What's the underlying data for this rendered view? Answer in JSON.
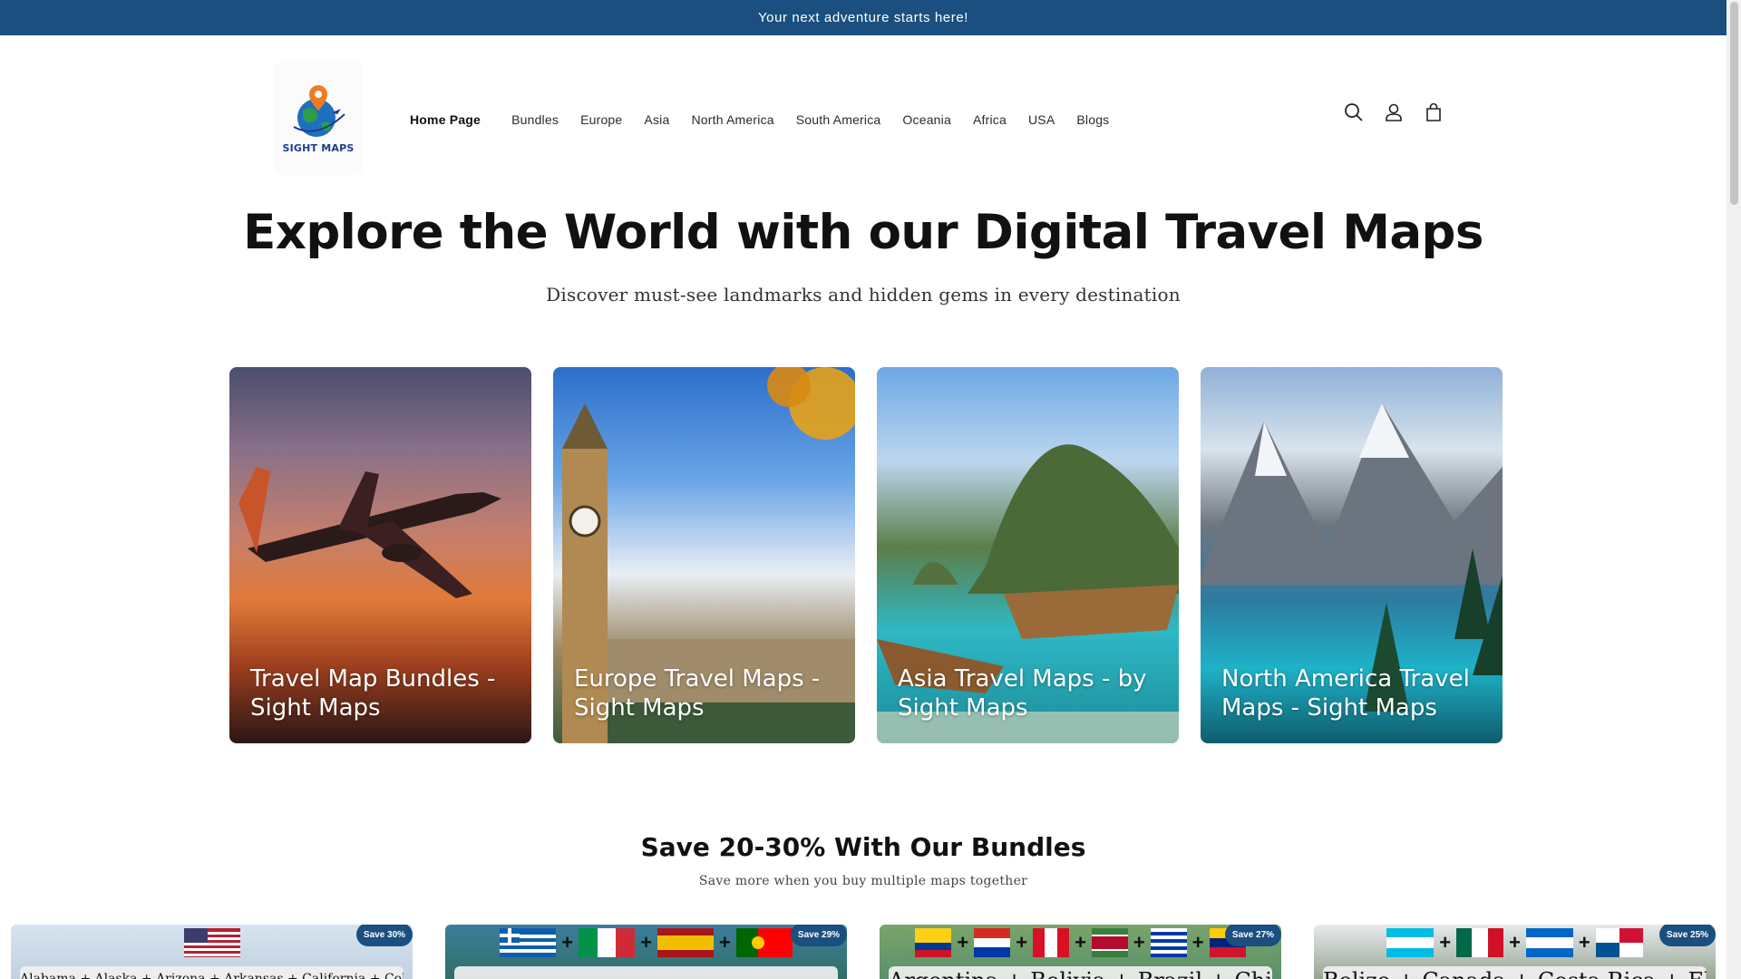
{
  "announcement": "Your next adventure starts here!",
  "logo": {
    "text": "SIGHT MAPS"
  },
  "nav": {
    "items": [
      "Home Page",
      "Bundles",
      "Europe",
      "Asia",
      "North America",
      "South America",
      "Oceania",
      "Africa",
      "USA",
      "Blogs"
    ],
    "active": "Home Page"
  },
  "header_icons": [
    "search-icon",
    "account-icon",
    "cart-icon"
  ],
  "hero": {
    "title": "Explore the World with our Digital Travel Maps",
    "subtitle": "Discover must-see landmarks and hidden gems in every destination"
  },
  "collections": [
    {
      "title": "Travel Map Bundles - Sight Maps"
    },
    {
      "title": "Europe Travel Maps - Sight Maps"
    },
    {
      "title": "Asia Travel Maps - by Sight Maps"
    },
    {
      "title": "North America Travel Maps - Sight Maps"
    }
  ],
  "bundles_section": {
    "title": "Save 20-30% With Our Bundles",
    "subtitle": "Save more when you buy multiple maps together"
  },
  "products": [
    {
      "badge": "Save 30%",
      "title_partial": "Alabama + Alaska + Arizona + Arkansas + California + Colorado +"
    },
    {
      "badge": "Save 29%",
      "title_partial": ""
    },
    {
      "badge": "Save 27%",
      "title_partial": "Argentina + Bolivia + Brazil + Chile"
    },
    {
      "badge": "Save 25%",
      "title_partial": "Belize + Canada + Costa Rica + El"
    }
  ],
  "colors": {
    "announcement_bg": "#1a4f7f",
    "badge_bg": "#1a4f7f",
    "text": "#121212"
  }
}
